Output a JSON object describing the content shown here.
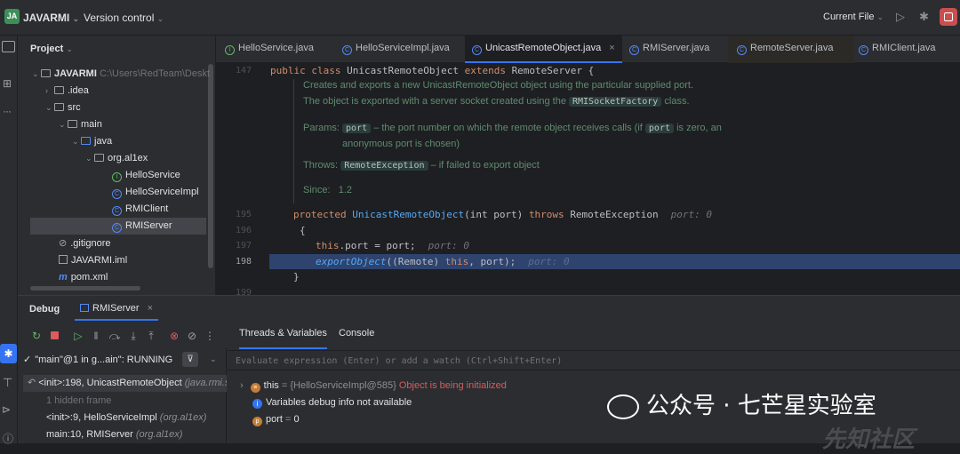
{
  "topbar": {
    "project_badge": "JA",
    "project_name": "JAVARMI",
    "vcs": "Version control",
    "run_config": "Current File"
  },
  "project_panel": {
    "title": "Project",
    "tree": [
      {
        "label": "JAVARMI",
        "path": "C:\\Users\\RedTeam\\Desktop",
        "type": "root"
      },
      {
        "label": ".idea",
        "type": "folder"
      },
      {
        "label": "src",
        "type": "folder"
      },
      {
        "label": "main",
        "type": "folder"
      },
      {
        "label": "java",
        "type": "folder"
      },
      {
        "label": "org.al1ex",
        "type": "package"
      },
      {
        "label": "HelloService",
        "type": "interface"
      },
      {
        "label": "HelloServiceImpl",
        "type": "class"
      },
      {
        "label": "RMIClient",
        "type": "class"
      },
      {
        "label": "RMIServer",
        "type": "class",
        "selected": true
      },
      {
        "label": ".gitignore",
        "type": "file"
      },
      {
        "label": "JAVARMI.iml",
        "type": "file"
      },
      {
        "label": "pom.xml",
        "type": "file"
      }
    ]
  },
  "tabs": [
    {
      "label": "HelloService.java",
      "icon": "interface-icon"
    },
    {
      "label": "HelloServiceImpl.java",
      "icon": "class-icon"
    },
    {
      "label": "UnicastRemoteObject.java",
      "icon": "class-icon",
      "active": true,
      "close": "×"
    },
    {
      "label": "RMIServer.java",
      "icon": "class-icon"
    },
    {
      "label": "RemoteServer.java",
      "icon": "class-icon"
    },
    {
      "label": "RMIClient.java",
      "icon": "class-icon"
    }
  ],
  "editor": {
    "line_numbers": [
      "147",
      "195",
      "196",
      "197",
      "198",
      "199"
    ],
    "line147": {
      "kw1": "public class",
      "name": "UnicastRemoteObject",
      "kw2": "extends",
      "parent": "RemoteServer {"
    },
    "doc": {
      "line1": "Creates and exports a new UnicastRemoteObject object using the particular supplied port.",
      "line2_pre": "The object is exported with a server socket created using the",
      "line2_chip": "RMISocketFactory",
      "line2_post": "class.",
      "params_label": "Params:",
      "params_chip": "port",
      "params_text1": "– the port number on which the remote object receives calls (if",
      "params_chip2": "port",
      "params_text2": "is zero, an",
      "params_text3": "anonymous port is chosen)",
      "throws_label": "Throws:",
      "throws_chip": "RemoteException",
      "throws_text": "– if failed to export object",
      "since_label": "Since:",
      "since_value": "1.2"
    },
    "line195": {
      "kw": "protected",
      "name": "UnicastRemoteObject",
      "args": "(int port)",
      "kw2": "throws",
      "exc": "RemoteException",
      "hint": "port: 0"
    },
    "line196": "{",
    "line197": {
      "kw": "this",
      "rest": ".port = port;",
      "hint": "port: 0"
    },
    "line198": {
      "call": "exportObject",
      "pre": "((Remote)",
      "kw": "this",
      "post": ", port);",
      "hint": "port: 0"
    },
    "line199": "}"
  },
  "debug": {
    "title": "Debug",
    "session": "RMIServer",
    "close": "×",
    "tabs": [
      "Threads & Variables",
      "Console"
    ],
    "thread": "\"main\"@1 in g...ain\": RUNNING",
    "frames": [
      {
        "method": "<init>:198, UnicastRemoteObject",
        "cls": "(java.rmi.s"
      },
      {
        "method": "1 hidden frame",
        "cls": ""
      },
      {
        "method": "<init>:9, HelloServiceImpl",
        "cls": "(org.al1ex)"
      },
      {
        "method": "main:10, RMIServer",
        "cls": "(org.al1ex)"
      }
    ],
    "eval_placeholder": "Evaluate expression (Enter) or add a watch (Ctrl+Shift+Enter)",
    "vars": [
      {
        "name": "this",
        "eq": "=",
        "value": "{HelloServiceImpl@585}",
        "extra": "Object is being initialized"
      },
      {
        "name": "Variables debug info not available",
        "eq": "",
        "value": "",
        "extra": ""
      },
      {
        "name": "port",
        "eq": "=",
        "value": "0",
        "extra": ""
      }
    ]
  },
  "watermark": {
    "text": "公众号 · 七芒星实验室",
    "corner": "先知社区"
  },
  "colors": {
    "accent": "#3574f0",
    "error_red": "#db5c5c",
    "current_line": "#2e436e"
  }
}
